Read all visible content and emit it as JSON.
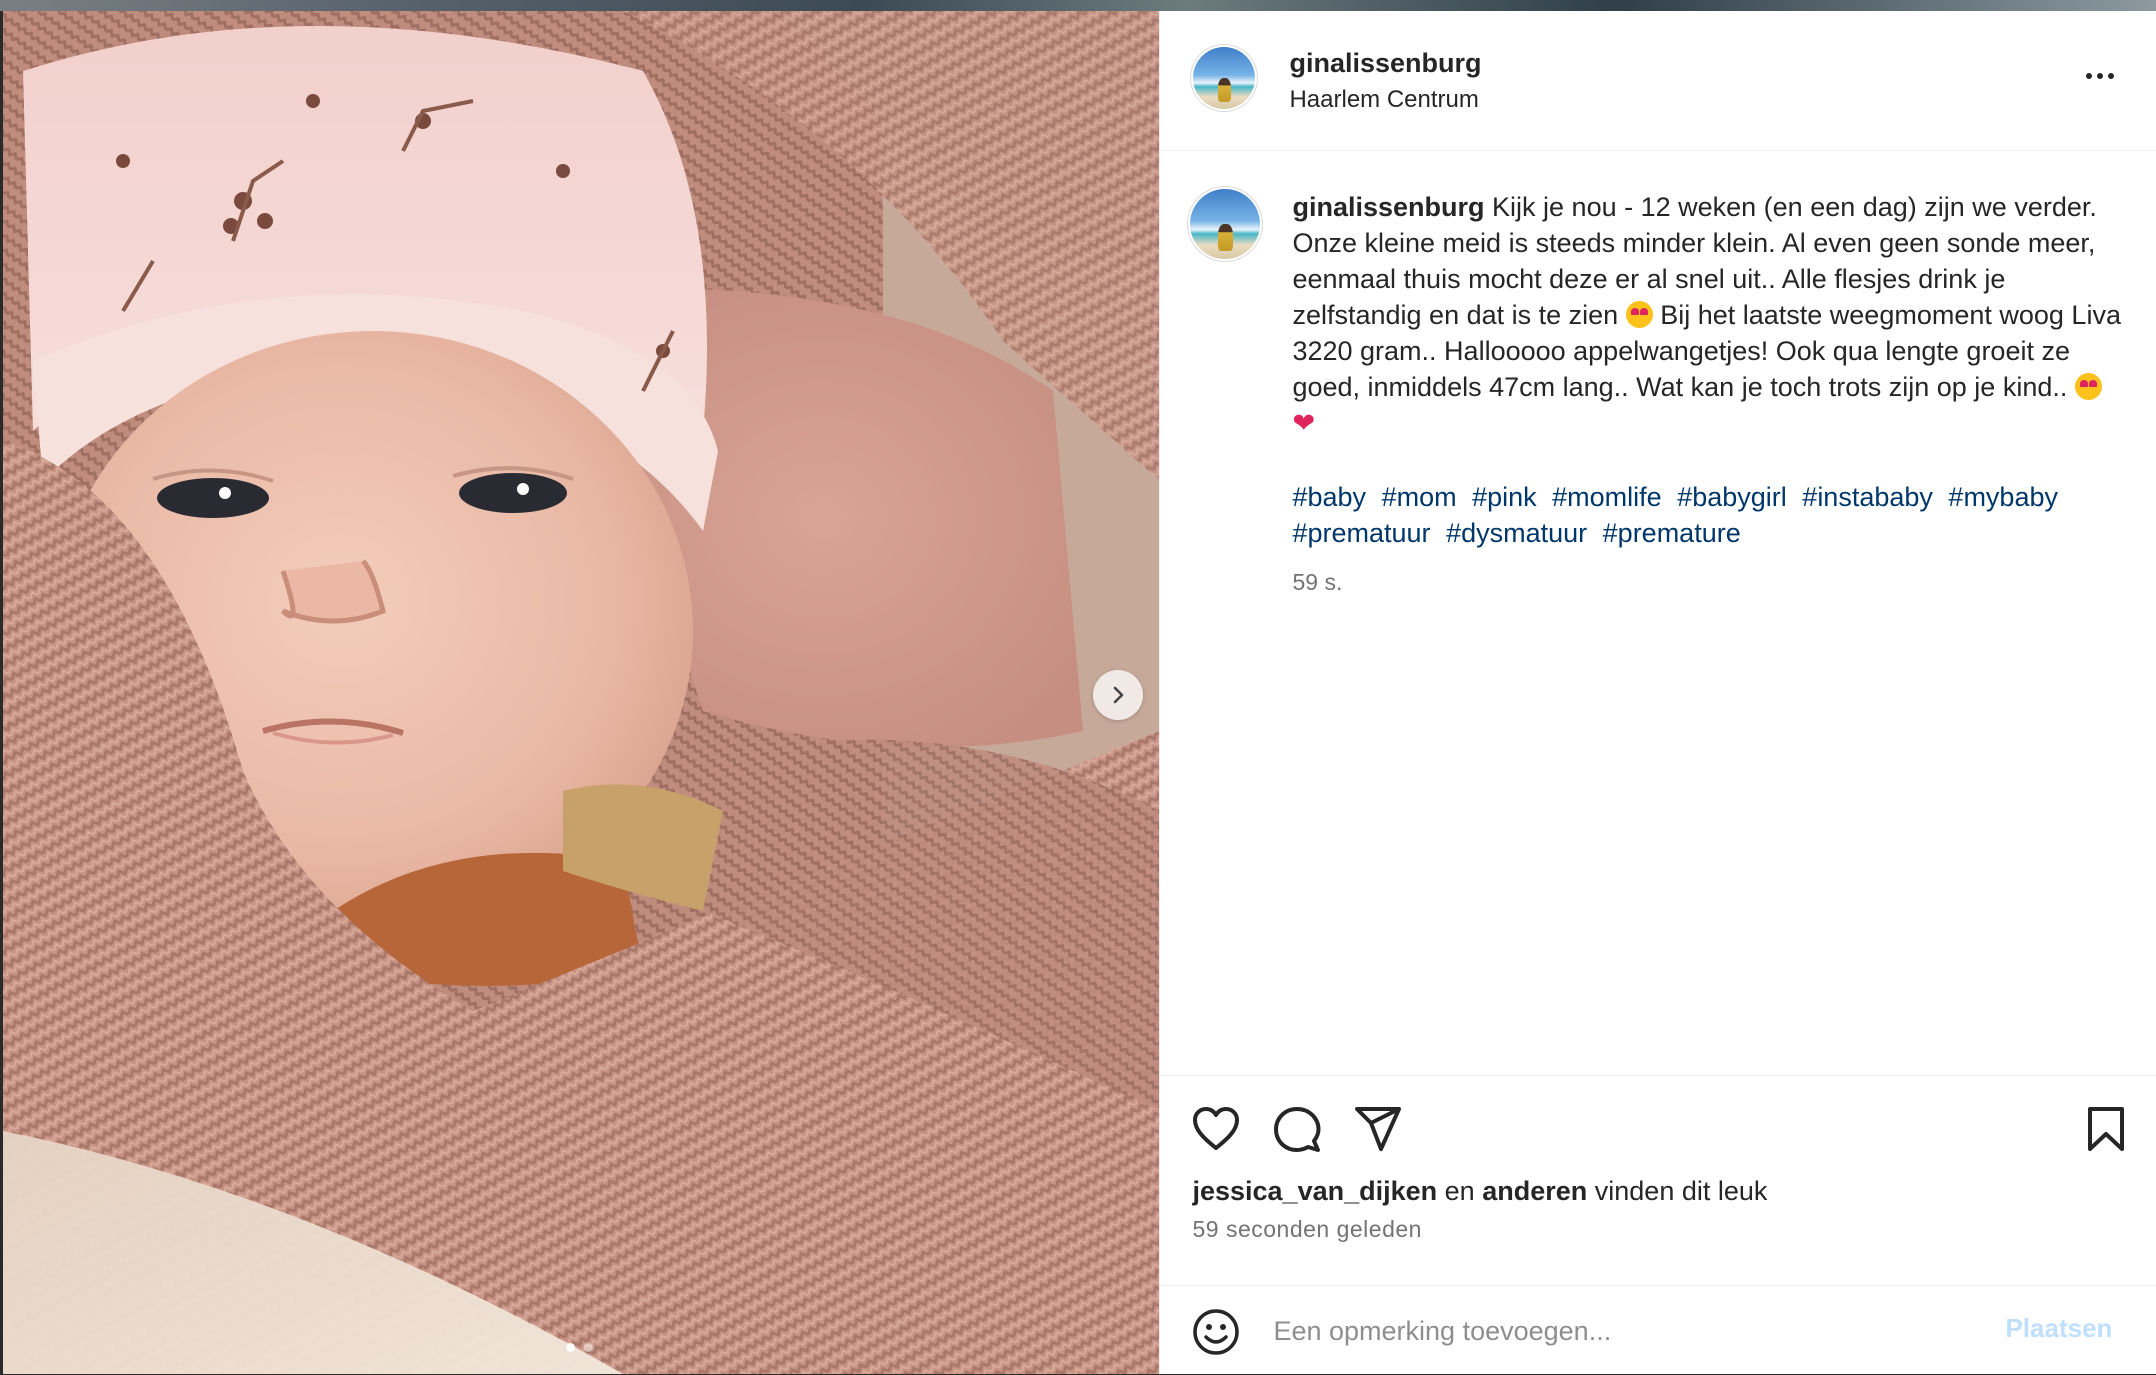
{
  "post": {
    "username": "ginalissenburg",
    "location": "Haarlem Centrum"
  },
  "caption": {
    "username": "ginalissenburg",
    "text_1": "Kijk je nou - 12 weken (en een dag) zijn we verder. Onze kleine meid is steeds minder klein. Al even geen sonde meer, eenmaal thuis mocht deze er al snel uit.. Alle flesjes drink je zelfstandig en dat is te zien",
    "text_2": "Bij het laatste weegmoment woog Liva 3220 gram.. Hallooooo appelwangetjes! Ook qua lengte groeit ze goed, inmiddels 47cm lang.. Wat kan je toch trots zijn op je kind..",
    "heart_glyph": "❤",
    "hashtags": [
      "#baby",
      "#mom",
      "#pink",
      "#momlife",
      "#babygirl",
      "#instababy",
      "#mybaby",
      "#prematuur",
      "#dysmatuur",
      "#premature"
    ],
    "time": "59 s."
  },
  "likes": {
    "user": "jessica_van_dijken",
    "en": "en",
    "others": "anderen",
    "suffix": "vinden dit leuk"
  },
  "timestamp": "59 seconden geleden",
  "comment": {
    "placeholder": "Een opmerking toevoegen...",
    "post_label": "Plaatsen"
  },
  "carousel": {
    "slide": 1,
    "total": 2
  },
  "colors": {
    "text": "#262626",
    "secondary": "#737373",
    "hashtag": "#00376b",
    "post_button_disabled": "#c0dffd"
  },
  "icons": [
    "more-icon",
    "heart-icon",
    "comment-icon",
    "share-icon",
    "bookmark-icon",
    "emoji-icon",
    "chevron-right-icon"
  ]
}
